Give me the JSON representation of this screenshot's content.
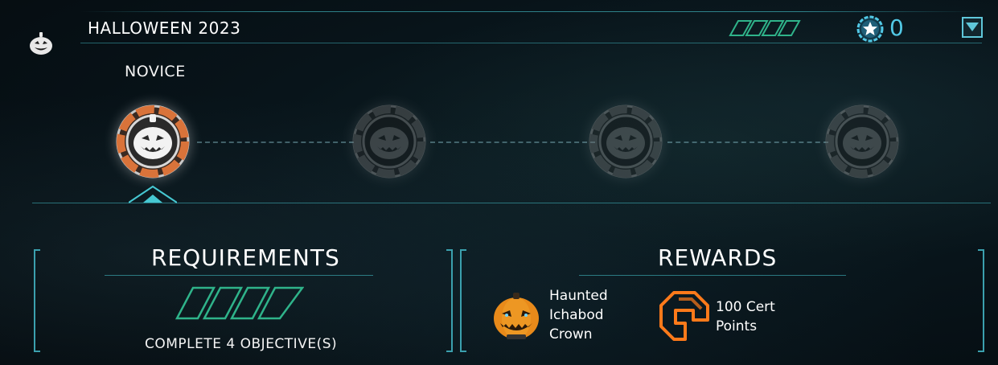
{
  "header": {
    "title": "HALLOWEEN 2023",
    "cert_count": "0",
    "icons": {
      "event": "pumpkin-icon",
      "cert": "star-cert-icon",
      "collapse": "collapse-arrow-icon"
    }
  },
  "track": {
    "current_tier": "NOVICE",
    "tiers": [
      {
        "state": "active"
      },
      {
        "state": "locked"
      },
      {
        "state": "locked"
      },
      {
        "state": "locked"
      }
    ]
  },
  "requirements": {
    "title": "REQUIREMENTS",
    "objective_text": "COMPLETE 4 OBJECTIVE(S)",
    "progress": {
      "completed": 0,
      "total": 4
    }
  },
  "rewards": {
    "title": "REWARDS",
    "items": [
      {
        "name": "Haunted\nIchabod\nCrown",
        "icon": "pumpkin-helmet-icon"
      },
      {
        "name": "100 Cert\nPoints",
        "icon": "cert-points-icon"
      }
    ]
  },
  "colors": {
    "accent": "#46c8d2",
    "cert_blue": "#52c9e6",
    "stripe_green": "#2fb38a",
    "active_orange": "#d9733a",
    "reward_orange": "#ff7a1a"
  }
}
